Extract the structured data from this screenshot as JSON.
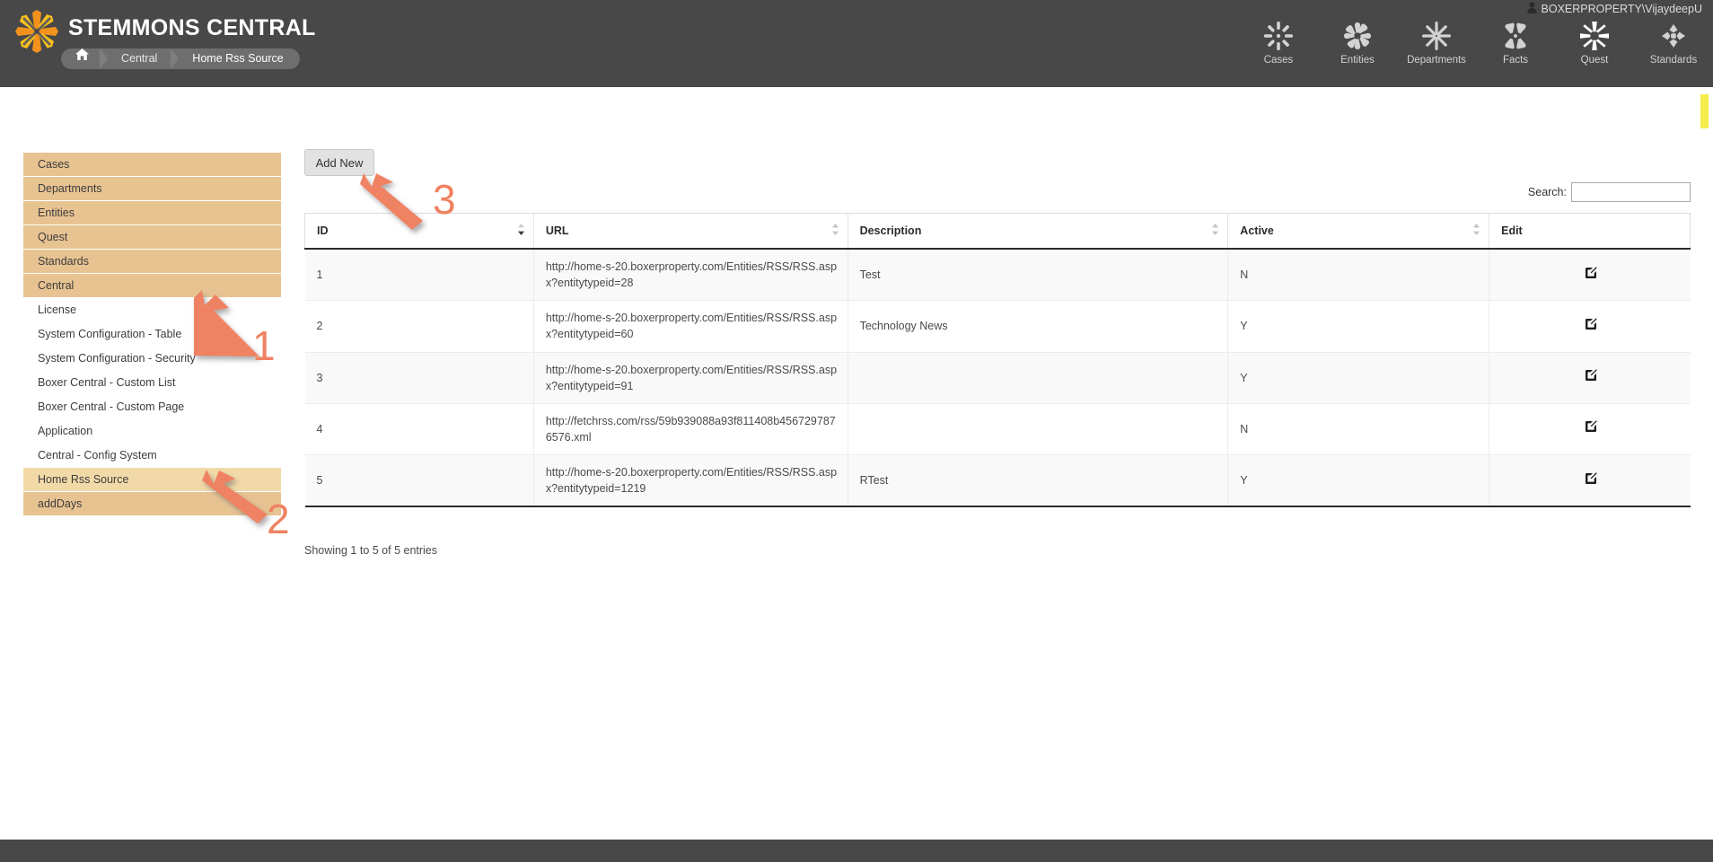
{
  "brand": {
    "title": "STEMMONS CENTRAL",
    "logo_icon": "burst-logo-icon",
    "logo_colors": {
      "orange": "#f2921d",
      "yellow": "#fbc11c"
    }
  },
  "breadcrumb": {
    "home_icon": "home-icon",
    "items": [
      {
        "label": "Central"
      },
      {
        "label": "Home Rss Source"
      }
    ]
  },
  "user": {
    "icon": "user-icon",
    "name": "BOXERPROPERTY\\VijaydeepU"
  },
  "topnav": {
    "items": [
      {
        "label": "Cases",
        "icon": "burst-cases-icon"
      },
      {
        "label": "Entities",
        "icon": "burst-entities-icon"
      },
      {
        "label": "Departments",
        "icon": "burst-departments-icon"
      },
      {
        "label": "Facts",
        "icon": "burst-facts-icon"
      },
      {
        "label": "Quest",
        "icon": "burst-quest-icon"
      },
      {
        "label": "Standards",
        "icon": "burst-standards-icon"
      }
    ]
  },
  "sidebar": {
    "items": [
      {
        "label": "Cases",
        "type": "group"
      },
      {
        "label": "Departments",
        "type": "group"
      },
      {
        "label": "Entities",
        "type": "group"
      },
      {
        "label": "Quest",
        "type": "group"
      },
      {
        "label": "Standards",
        "type": "group"
      },
      {
        "label": "Central",
        "type": "group"
      },
      {
        "label": "License",
        "type": "child"
      },
      {
        "label": "System Configuration - Table",
        "type": "child"
      },
      {
        "label": "System Configuration - Security",
        "type": "child"
      },
      {
        "label": "Boxer Central - Custom List",
        "type": "child"
      },
      {
        "label": "Boxer Central - Custom Page",
        "type": "child"
      },
      {
        "label": "Application",
        "type": "child"
      },
      {
        "label": "Central - Config System",
        "type": "child"
      },
      {
        "label": "Home Rss Source",
        "type": "selected"
      },
      {
        "label": "addDays",
        "type": "group"
      }
    ]
  },
  "toolbar": {
    "add_new_label": "Add New"
  },
  "search": {
    "label": "Search:",
    "value": "",
    "placeholder": ""
  },
  "table": {
    "columns": [
      {
        "label": "ID",
        "sort": "asc"
      },
      {
        "label": "URL",
        "sort": "neutral"
      },
      {
        "label": "Description",
        "sort": "neutral"
      },
      {
        "label": "Active",
        "sort": "neutral"
      },
      {
        "label": "Edit",
        "sort": "none"
      }
    ],
    "rows": [
      {
        "id": "1",
        "url": "http://home-s-20.boxerproperty.com/Entities/RSS/RSS.aspx?entitytypeid=28",
        "description": "Test",
        "active": "N",
        "edit_icon": "edit-pencil-square-icon"
      },
      {
        "id": "2",
        "url": "http://home-s-20.boxerproperty.com/Entities/RSS/RSS.aspx?entitytypeid=60",
        "description": "Technology News",
        "active": "Y",
        "edit_icon": "edit-pencil-square-icon"
      },
      {
        "id": "3",
        "url": "http://home-s-20.boxerproperty.com/Entities/RSS/RSS.aspx?entitytypeid=91",
        "description": "",
        "active": "Y",
        "edit_icon": "edit-pencil-square-icon"
      },
      {
        "id": "4",
        "url": "http://fetchrss.com/rss/59b939088a93f811408b4567297876576.xml",
        "description": "",
        "active": "N",
        "edit_icon": "edit-pencil-square-icon"
      },
      {
        "id": "5",
        "url": "http://home-s-20.boxerproperty.com/Entities/RSS/RSS.aspx?entitytypeid=1219",
        "description": "RTest",
        "active": "Y",
        "edit_icon": "edit-pencil-square-icon"
      }
    ],
    "info": "Showing 1 to 5 of 5 entries"
  },
  "annotations": {
    "color": "#ef8262",
    "markers": [
      {
        "label": "1"
      },
      {
        "label": "2"
      },
      {
        "label": "3"
      }
    ]
  },
  "colors": {
    "header_bg": "#484848",
    "sidebar_group": "#e8c392",
    "sidebar_selected": "#f2daa8",
    "accent_yellow": "#f5ec4a",
    "annotation": "#ef8262"
  }
}
